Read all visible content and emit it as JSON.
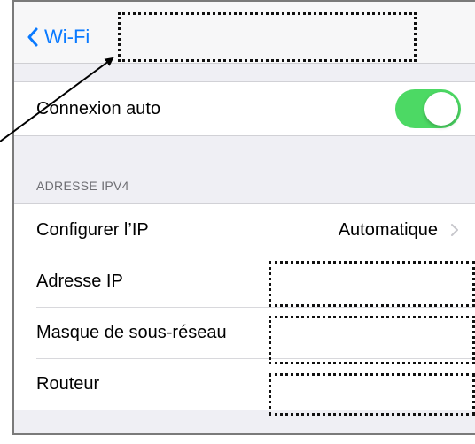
{
  "navbar": {
    "back_label": "Wi-Fi"
  },
  "auto_section": {
    "auto_join_label": "Connexion auto",
    "auto_join_enabled": true
  },
  "ipv4_section": {
    "header": "ADRESSE IPV4",
    "configure_ip_label": "Configurer l’IP",
    "configure_ip_value": "Automatique",
    "ip_address_label": "Adresse IP",
    "subnet_mask_label": "Masque de sous-réseau",
    "router_label": "Routeur"
  },
  "colors": {
    "accent": "#0a7aff",
    "toggle_on": "#4cd964",
    "background": "#efeff4"
  },
  "icons": {
    "back": "chevron-left-icon",
    "disclosure": "chevron-right-icon"
  }
}
